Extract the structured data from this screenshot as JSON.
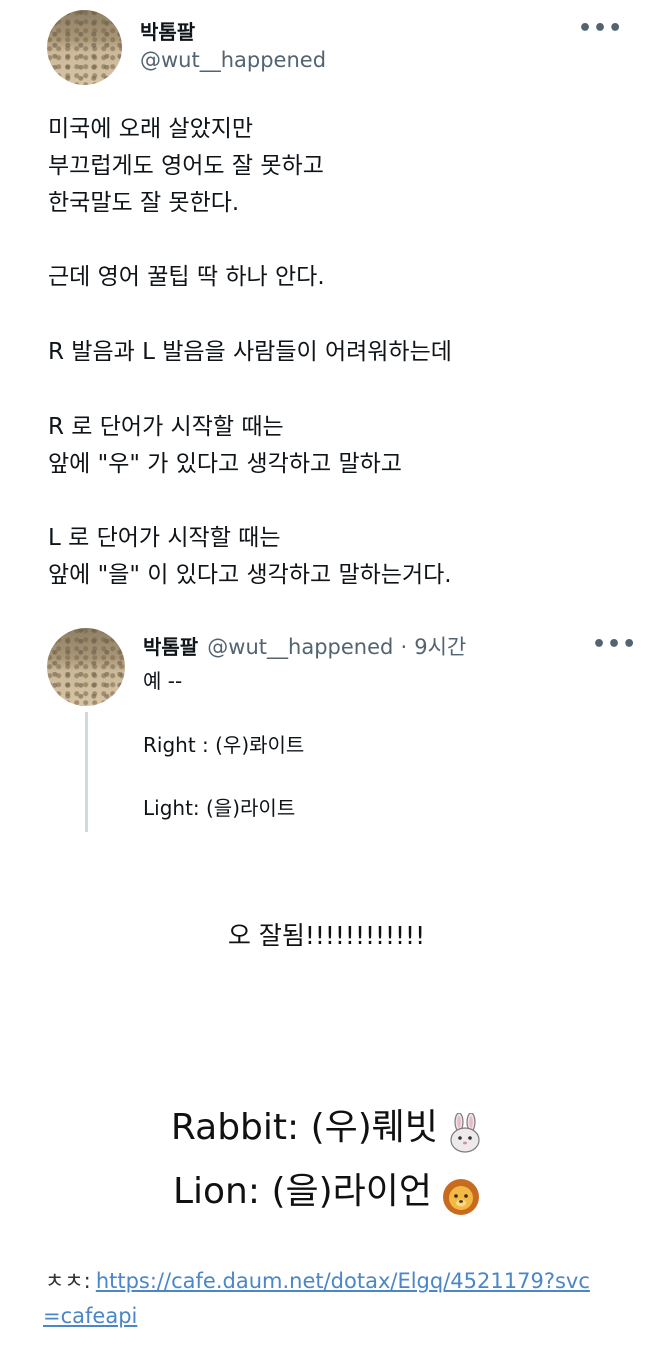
{
  "tweet": {
    "author_name": "박톰팔",
    "author_handle": "@wut__happened",
    "more_icon": "more-horizontal-icon",
    "body_lines": [
      "미국에 오래 살았지만",
      "부끄럽게도 영어도 잘 못하고",
      "한국말도 잘 못한다.",
      "근데 영어 꿀팁 딱 하나 안다.",
      "R 발음과 L 발음을 사람들이 어려워하는데",
      "R 로 단어가 시작할 때는",
      "앞에 \"우\" 가 있다고 생각하고 말하고",
      "L 로 단어가 시작할 때는",
      "앞에 \"을\" 이 있다고 생각하고 말하는거다."
    ]
  },
  "reply": {
    "author_name": "박톰팔",
    "author_handle": "@wut__happened",
    "separator": "·",
    "time": "9시간",
    "lines": [
      "예 --",
      "Right : (우)롸이트",
      "Light: (을)라이트"
    ]
  },
  "caption": "오 잘됨!!!!!!!!!!!!",
  "examples": [
    {
      "text": "Rabbit: (우)뤠빗",
      "icon": "rabbit-icon"
    },
    {
      "text": "Lion: (을)라이언",
      "icon": "lion-icon"
    }
  ],
  "source": {
    "label": "ㅊㅊ:",
    "url_line1": "https://cafe.daum.net/dotax/Elgq/4521179?svc",
    "url_line2": "=cafeapi"
  }
}
